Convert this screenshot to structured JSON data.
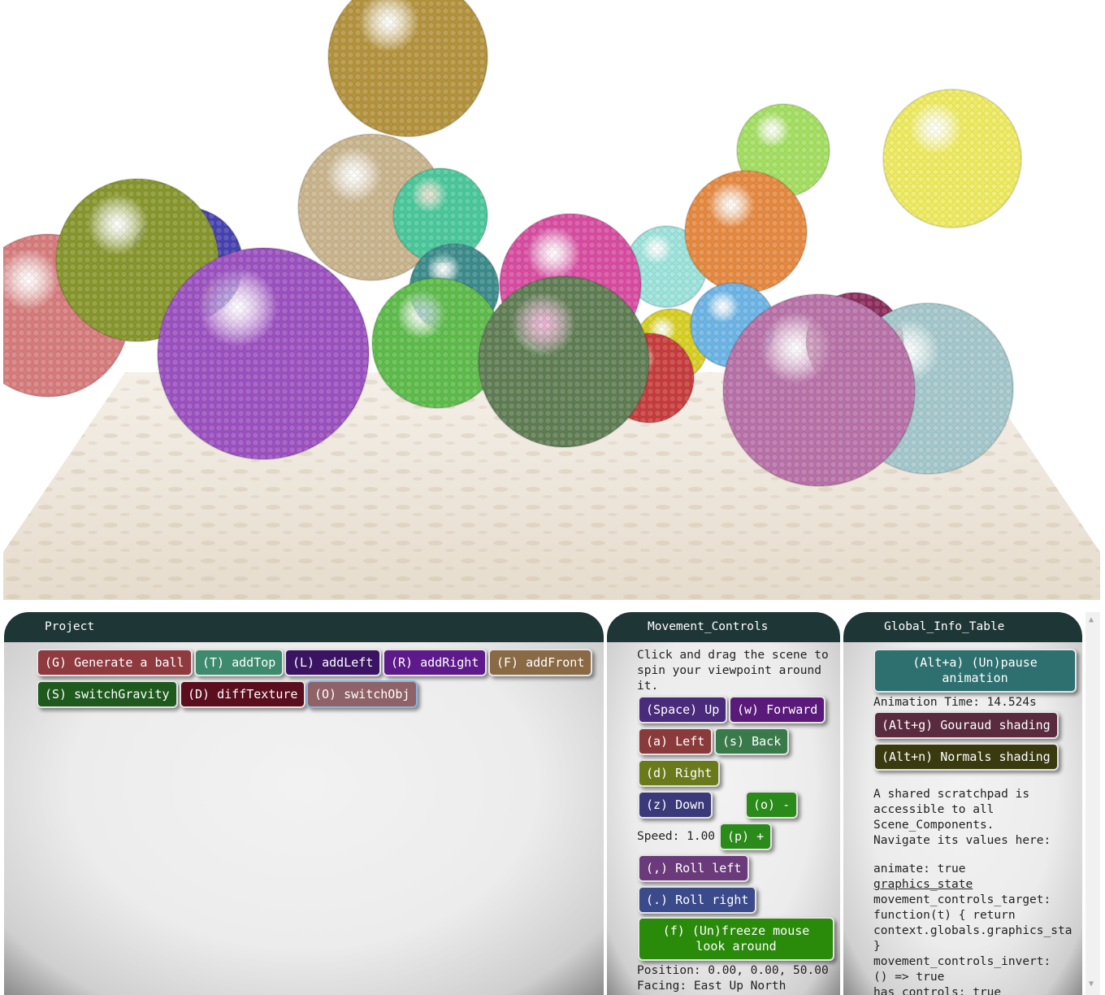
{
  "scene": {
    "floor_color": "#ede4d7",
    "balls": [
      {
        "name": "mustard",
        "color": "#b3923a"
      },
      {
        "name": "pink",
        "color": "#d77a7a"
      },
      {
        "name": "blue",
        "color": "#4440b0"
      },
      {
        "name": "olive",
        "color": "#86962a"
      },
      {
        "name": "tan",
        "color": "#c9b48c"
      },
      {
        "name": "mint",
        "color": "#48c89a"
      },
      {
        "name": "teal",
        "color": "#3a8a8a"
      },
      {
        "name": "purple",
        "color": "#9b4fc0"
      },
      {
        "name": "magenta",
        "color": "#d84aa0"
      },
      {
        "name": "green",
        "color": "#5cbc48"
      },
      {
        "name": "cyan",
        "color": "#9ce4dc"
      },
      {
        "name": "lime",
        "color": "#a4e060"
      },
      {
        "name": "orange",
        "color": "#e6883e"
      },
      {
        "name": "yellow",
        "color": "#f0ec60"
      },
      {
        "name": "sky",
        "color": "#6ab4e6"
      },
      {
        "name": "red",
        "color": "#c83a3a"
      },
      {
        "name": "gold",
        "color": "#d8d020"
      },
      {
        "name": "darkgreen",
        "color": "#5e7c52"
      },
      {
        "name": "plum",
        "color": "#8c2a5c"
      },
      {
        "name": "lightblue",
        "color": "#a4c8cc"
      },
      {
        "name": "mauve",
        "color": "#b870a8"
      }
    ]
  },
  "project": {
    "title": "Project",
    "buttons": [
      {
        "label": "(G) Generate a ball",
        "color": "#8e3a3e"
      },
      {
        "label": "(T) addTop",
        "color": "#3e8a6e"
      },
      {
        "label": "(L) addLeft",
        "color": "#3a1462"
      },
      {
        "label": "(R) addRight",
        "color": "#5e1a8a"
      },
      {
        "label": "(F) addFront",
        "color": "#8a6a44"
      },
      {
        "label": "(S) switchGravity",
        "color": "#1e5a1e"
      },
      {
        "label": "(D) diffTexture",
        "color": "#5a0e1e"
      },
      {
        "label": "(O) switchObj",
        "color": "#8e6266"
      }
    ]
  },
  "movement": {
    "title": "Movement_Controls",
    "intro": "Click and drag the scene to\nspin your viewpoint around\nit.",
    "buttons": {
      "up": {
        "label": "(Space) Up",
        "color": "#4a2a7a"
      },
      "forward": {
        "label": "(w) Forward",
        "color": "#5a1a7a"
      },
      "left": {
        "label": "(a) Left",
        "color": "#8a3a3a"
      },
      "back": {
        "label": "(s) Back",
        "color": "#3a7a4a"
      },
      "right": {
        "label": "(d) Right",
        "color": "#6a7a1a"
      },
      "down": {
        "label": "(z) Down",
        "color": "#3a3a7a"
      },
      "slower": {
        "label": "(o) -",
        "color": "#2a8a1a"
      },
      "faster": {
        "label": "(p) +",
        "color": "#2a8a1a"
      },
      "roll_left": {
        "label": "(,) Roll left",
        "color": "#6a3a7a"
      },
      "roll_right": {
        "label": "(.) Roll right",
        "color": "#3a4a8a"
      },
      "freeze": {
        "label": "(f) (Un)freeze mouse look around",
        "color": "#2a8a0a"
      }
    },
    "speed_label": "Speed: 1.00",
    "position": "Position: 0.00, 0.00, 50.00",
    "facing": "Facing: East Up North"
  },
  "info": {
    "title": "Global_Info_Table",
    "pause_button": {
      "label": "(Alt+a) (Un)pause animation",
      "color": "#2e7070"
    },
    "animation_time": "Animation Time: 14.524s",
    "gouraud_button": {
      "label": "(Alt+g) Gouraud shading",
      "color": "#5a2a3e"
    },
    "normals_button": {
      "label": "(Alt+n) Normals shading",
      "color": "#3a3a10"
    },
    "scratchpad": "A shared scratchpad is\naccessible to all\nScene_Components.\nNavigate its values here:",
    "animate": "animate: true",
    "graphics_state": "graphics_state",
    "code_lines": "movement_controls_target:\nfunction(t) { return\ncontext.globals.graphics_sta\n}\nmovement_controls_invert:\n() => true\nhas_controls: true"
  }
}
